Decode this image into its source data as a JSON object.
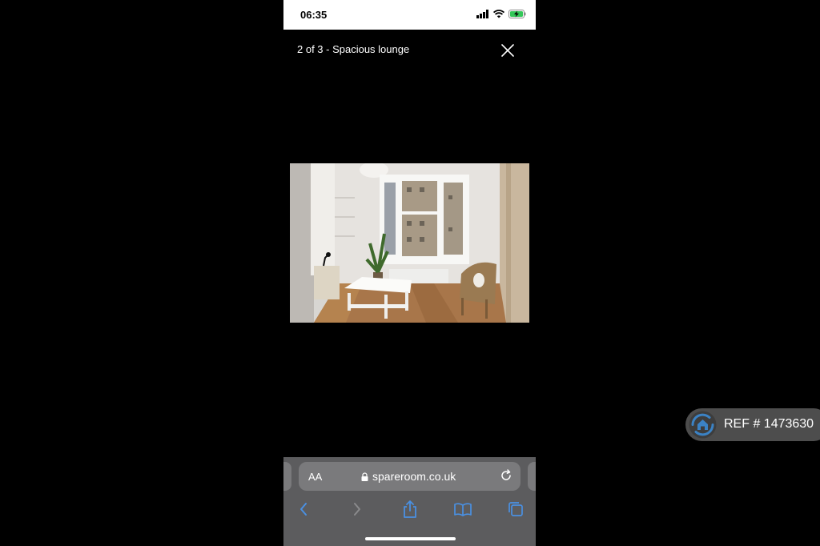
{
  "status_bar": {
    "time": "06:35"
  },
  "viewer": {
    "caption": "2 of 3 - Spacious lounge"
  },
  "browser": {
    "text_size_label": "AA",
    "url": "spareroom.co.uk"
  },
  "ref_badge": {
    "label": "REF # 1473630"
  },
  "colors": {
    "accent_blue": "#3b82c4",
    "battery_green": "#34c759",
    "toolbar_gray": "#5c5c5e"
  },
  "icons": {
    "signal": "signal-icon",
    "wifi": "wifi-icon",
    "battery": "battery-charging-icon",
    "close": "close-icon",
    "lock": "lock-icon",
    "reload": "reload-icon",
    "back": "back-icon",
    "forward": "forward-icon",
    "share": "share-icon",
    "bookmarks": "bookmarks-icon",
    "tabs": "tabs-icon",
    "home": "home-icon"
  }
}
